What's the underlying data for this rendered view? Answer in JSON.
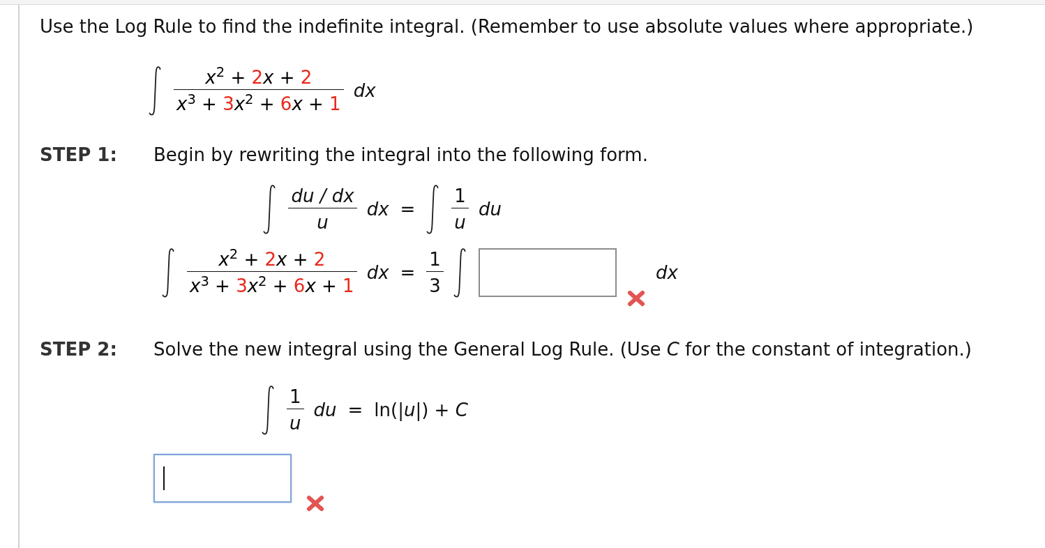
{
  "instruction": "Use the Log Rule to find the indefinite integral. (Remember to use absolute values where appropriate.)",
  "problem": {
    "items": [
      {
        "kind": "integral"
      },
      {
        "kind": "fraction",
        "numerator": {
          "parts": [
            {
              "text": "*x*$^{2}$ + ",
              "color": "#000000"
            },
            {
              "text": "2",
              "color": "#e8291c"
            },
            {
              "text": "*x* + ",
              "color": "#000000"
            },
            {
              "text": "2",
              "color": "#e8291c"
            }
          ]
        },
        "denominator": {
          "parts": [
            {
              "text": "*x*$^{3}$ + ",
              "color": "#000000"
            },
            {
              "text": "3",
              "color": "#e8291c"
            },
            {
              "text": "*x*$^{2}$ + ",
              "color": "#000000"
            },
            {
              "text": "6",
              "color": "#e8291c"
            },
            {
              "text": "*x* + ",
              "color": "#000000"
            },
            {
              "text": "1",
              "color": "#e8291c"
            }
          ]
        }
      },
      {
        "kind": "term",
        "text": "dx",
        "italic": true
      }
    ]
  },
  "steps": [
    {
      "label": "STEP 1:",
      "prompt": "Begin by rewriting the integral into the following form.",
      "rows": [
        {
          "items": [
            {
              "kind": "integral"
            },
            {
              "kind": "fraction",
              "numerator": {
                "text": "du / dx",
                "italic": true
              },
              "denominator": {
                "text": "u",
                "italic": true
              }
            },
            {
              "kind": "term",
              "text": "dx",
              "italic": true
            },
            {
              "kind": "relation",
              "text": "="
            },
            {
              "kind": "integral"
            },
            {
              "kind": "fraction",
              "numerator": {
                "text": "1",
                "italic": false
              },
              "denominator": {
                "text": "u",
                "italic": true
              }
            },
            {
              "kind": "term",
              "text": "du",
              "italic": true
            }
          ]
        },
        {
          "items": [
            {
              "kind": "integral"
            },
            {
              "kind": "fraction",
              "numerator": {
                "parts": [
                  {
                    "text": "*x*$^{2}$ + ",
                    "color": "#000000"
                  },
                  {
                    "text": "2",
                    "color": "#e8291c"
                  },
                  {
                    "text": "*x* + ",
                    "color": "#000000"
                  },
                  {
                    "text": "2",
                    "color": "#e8291c"
                  }
                ]
              },
              "denominator": {
                "parts": [
                  {
                    "text": "*x*$^{3}$ + ",
                    "color": "#000000"
                  },
                  {
                    "text": "3",
                    "color": "#e8291c"
                  },
                  {
                    "text": "*x*$^{2}$ + ",
                    "color": "#000000"
                  },
                  {
                    "text": "6",
                    "color": "#e8291c"
                  },
                  {
                    "text": "*x* + ",
                    "color": "#000000"
                  },
                  {
                    "text": "1",
                    "color": "#e8291c"
                  }
                ]
              }
            },
            {
              "kind": "term",
              "text": "dx",
              "italic": true
            },
            {
              "kind": "relation",
              "text": "="
            },
            {
              "kind": "fraction",
              "numerator": {
                "text": "1",
                "italic": false
              },
              "denominator": {
                "text": "3",
                "italic": false
              }
            },
            {
              "kind": "integral"
            },
            {
              "kind": "answer_field",
              "focused": false
            },
            {
              "kind": "feedback",
              "correct": false
            },
            {
              "kind": "term",
              "text": "dx",
              "italic": true
            }
          ]
        }
      ]
    },
    {
      "label": "STEP 2:",
      "prompt": "Solve the new integral using the General Log Rule. (Use *C* for the constant of integration.)",
      "rows": [
        {
          "items": [
            {
              "kind": "integral"
            },
            {
              "kind": "fraction",
              "numerator": {
                "text": "1",
                "italic": false
              },
              "denominator": {
                "text": "u",
                "italic": true
              }
            },
            {
              "kind": "term",
              "text": "du",
              "italic": true
            },
            {
              "kind": "relation",
              "text": "="
            },
            {
              "kind": "term",
              "text": "ln(|*u*|) + *C*",
              "italic": false
            }
          ]
        },
        {
          "items": [
            {
              "kind": "answer_field",
              "focused": true
            },
            {
              "kind": "feedback",
              "correct": false
            }
          ]
        }
      ]
    }
  ]
}
